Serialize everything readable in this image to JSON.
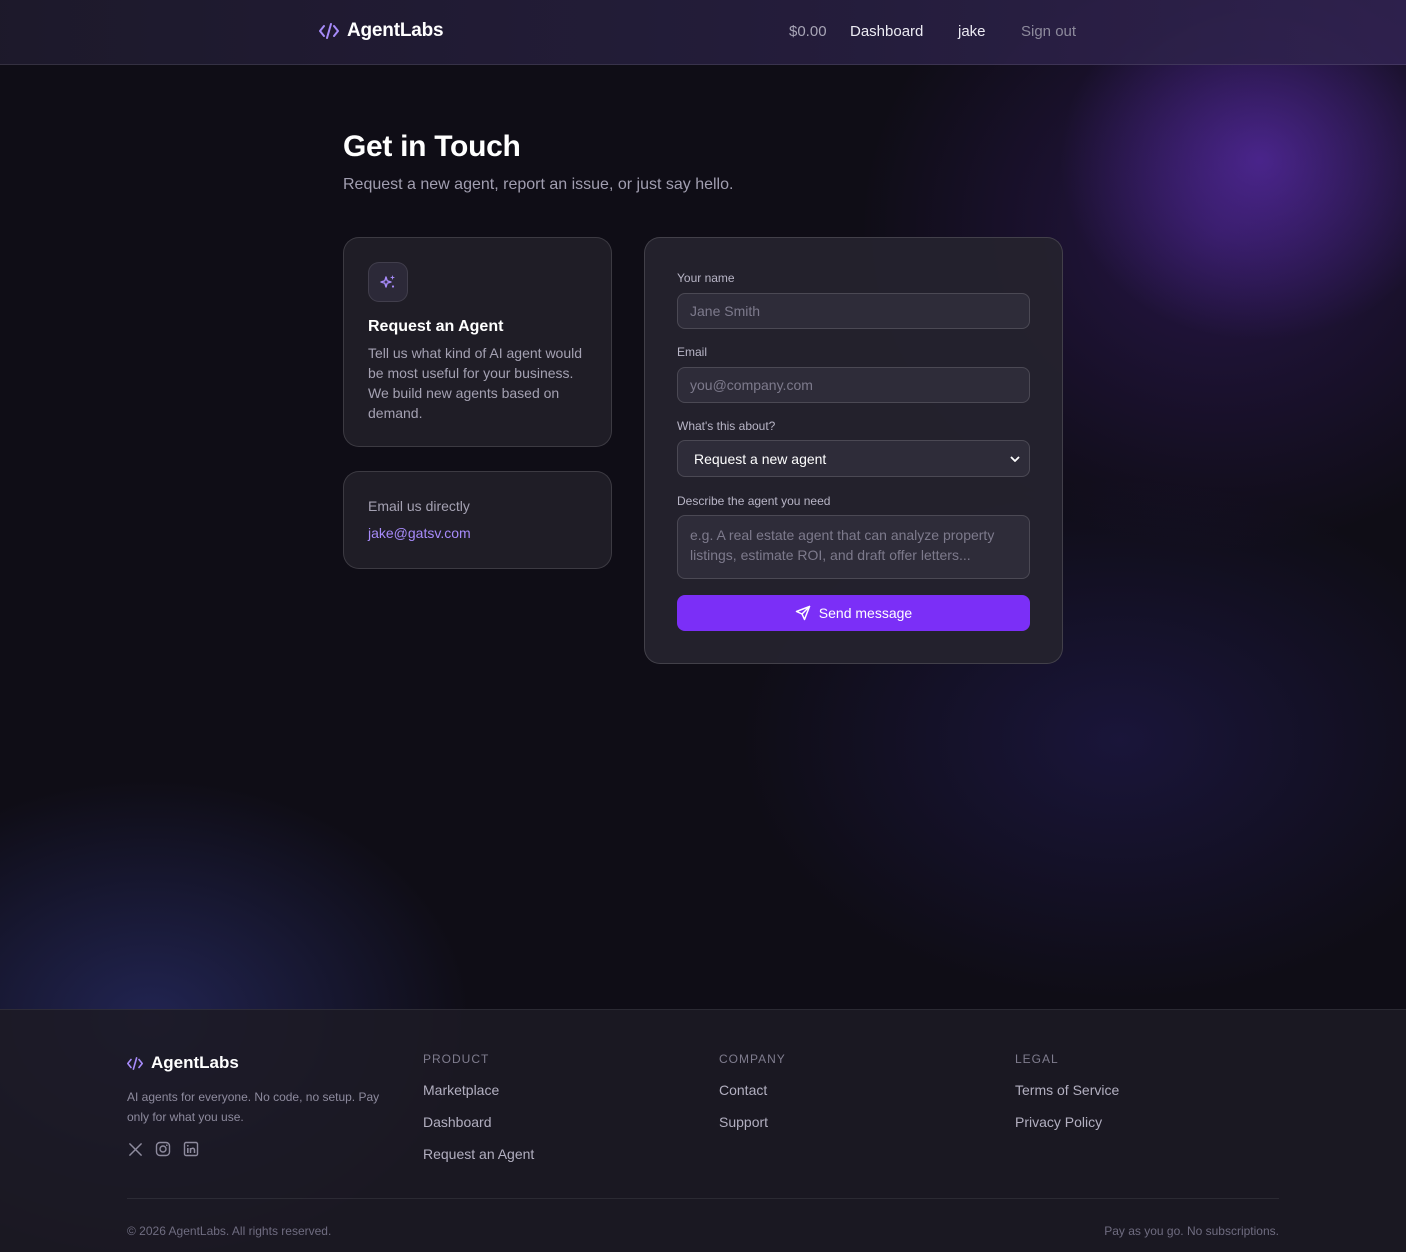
{
  "header": {
    "brand": "AgentLabs",
    "balance": "$0.00",
    "dashboard": "Dashboard",
    "user": "jake",
    "sign_out": "Sign out"
  },
  "hero": {
    "title": "Get in Touch",
    "subtitle": "Request a new agent, report an issue, or just say hello."
  },
  "request_card": {
    "title": "Request an Agent",
    "description": "Tell us what kind of AI agent would be most useful for your business. We build new agents based on demand."
  },
  "email_card": {
    "label": "Email us directly",
    "email": "jake@gatsv.com"
  },
  "form": {
    "name_label": "Your name",
    "name_placeholder": "Jane Smith",
    "email_label": "Email",
    "email_placeholder": "you@company.com",
    "topic_label": "What's this about?",
    "topic_value": "Request a new agent",
    "describe_label": "Describe the agent you need",
    "describe_placeholder": "e.g. A real estate agent that can analyze property listings, estimate ROI, and draft offer letters...",
    "send_label": "Send message"
  },
  "footer": {
    "brand": "AgentLabs",
    "tagline": "AI agents for everyone. No code, no setup. Pay only for what you use.",
    "columns": [
      {
        "heading": "PRODUCT",
        "links": [
          "Marketplace",
          "Dashboard",
          "Request an Agent"
        ]
      },
      {
        "heading": "COMPANY",
        "links": [
          "Contact",
          "Support"
        ]
      },
      {
        "heading": "LEGAL",
        "links": [
          "Terms of Service",
          "Privacy Policy"
        ]
      }
    ],
    "copyright": "© 2026 AgentLabs. All rights reserved.",
    "pay_line": "Pay as you go. No subscriptions."
  },
  "colors": {
    "accent": "#7b2ff7",
    "link": "#a78bfa",
    "background": "#0f0d16"
  },
  "icons": {
    "brand": "code-icon",
    "request_card": "sparkles-icon",
    "send": "send-icon",
    "social": [
      "x-icon",
      "instagram-icon",
      "linkedin-icon"
    ]
  }
}
